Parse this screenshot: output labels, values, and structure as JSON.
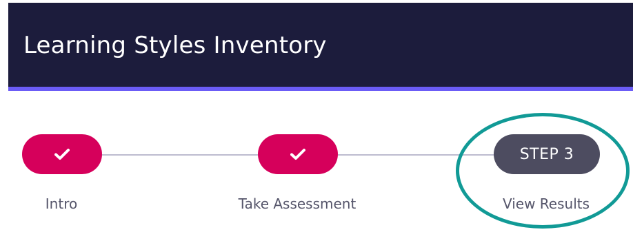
{
  "header": {
    "title": "Learning Styles Inventory",
    "background_color": "#1c1c3c",
    "accent_border_color": "#6b5cf6"
  },
  "stepper": {
    "steps": [
      {
        "label": "Intro",
        "status": "completed",
        "icon": "check-icon"
      },
      {
        "label": "Take Assessment",
        "status": "completed",
        "icon": "check-icon"
      },
      {
        "label": "View Results",
        "status": "current",
        "pill_text": "STEP 3"
      }
    ],
    "completed_color": "#d6005b",
    "current_color": "#4d4c60",
    "connector_color": "#bdbccf"
  },
  "annotation": {
    "highlight_ring_color": "#119a96"
  }
}
